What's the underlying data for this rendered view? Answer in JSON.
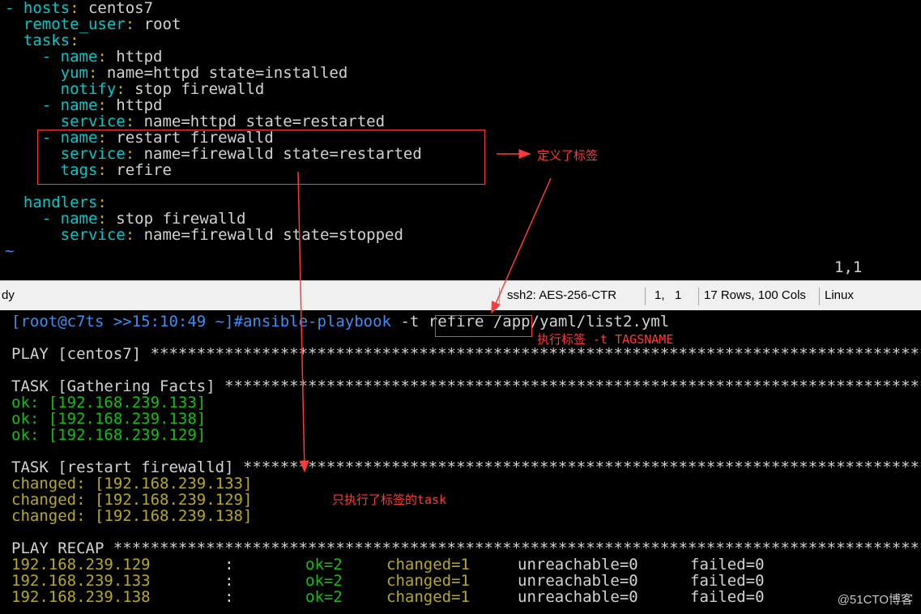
{
  "editor": {
    "lines": [
      {
        "key": "- hosts",
        "value": " centos7",
        "indent": ""
      },
      {
        "key": "remote_user",
        "value": " root",
        "indent": "  "
      },
      {
        "key": "tasks",
        "value": "",
        "indent": "  "
      },
      {
        "key": "- name",
        "value": " httpd",
        "indent": "    "
      },
      {
        "key": "yum",
        "value": " name=httpd state=installed",
        "indent": "      "
      },
      {
        "key": "notify",
        "value": " stop firewalld",
        "indent": "      "
      },
      {
        "key": "- name",
        "value": " httpd",
        "indent": "    "
      },
      {
        "key": "service",
        "value": " name=httpd state=restarted",
        "indent": "      "
      },
      {
        "key": "- name",
        "value": " restart firewalld",
        "indent": "    "
      },
      {
        "key": "service",
        "value": " name=firewalld state=restarted",
        "indent": "      "
      },
      {
        "key": "tags",
        "value": " refire",
        "indent": "      "
      },
      {
        "key": "",
        "value": "",
        "indent": ""
      },
      {
        "key": "handlers",
        "value": "",
        "indent": "  "
      },
      {
        "key": "- name",
        "value": " stop firewalld",
        "indent": "    "
      },
      {
        "key": "service",
        "value": " name=firewalld state=stopped",
        "indent": "      "
      }
    ],
    "tilde": "~",
    "cursor_pos": "1,1"
  },
  "status_bar": {
    "left": "dy",
    "cipher": "ssh2: AES-256-CTR",
    "position": "1,   1",
    "size": "17 Rows, 100 Cols",
    "os": "Linux"
  },
  "terminal": {
    "prompt": "[root@c7ts >>15:10:49 ~]#ansible-playbook ",
    "tag_option": "-t refire",
    "playbook_path": " /app/yaml/list2.yml",
    "play_header": "PLAY [centos7] ****************************************************************************************************",
    "task_gather": "TASK [Gathering Facts] *********************************************************************************************",
    "ok_hosts": [
      "ok: [192.168.239.133]",
      "ok: [192.168.239.138]",
      "ok: [192.168.239.129]"
    ],
    "task_restart": "TASK [restart firewalld] *******************************************************************************************",
    "changed_hosts": [
      "changed: [192.168.239.133]",
      "changed: [192.168.239.129]",
      "changed: [192.168.239.138]"
    ],
    "recap_header": "PLAY RECAP *********************************************************************************************************",
    "recap": [
      {
        "host": "192.168.239.129",
        "sep": "        : ",
        "ok": "ok=2",
        "changed": "changed=1",
        "unreachable": "unreachable=0",
        "failed": "failed=0"
      },
      {
        "host": "192.168.239.133",
        "sep": "        : ",
        "ok": "ok=2",
        "changed": "changed=1",
        "unreachable": "unreachable=0",
        "failed": "failed=0"
      },
      {
        "host": "192.168.239.138",
        "sep": "        : ",
        "ok": "ok=2",
        "changed": "changed=1",
        "unreachable": "unreachable=0",
        "failed": "failed=0"
      }
    ]
  },
  "annotations": {
    "defined_tag": "定义了标签",
    "exec_tag": "执行标签 -t TAGSNAME",
    "only_exec": "只执行了标签的task"
  },
  "watermark": "@51CTO博客"
}
